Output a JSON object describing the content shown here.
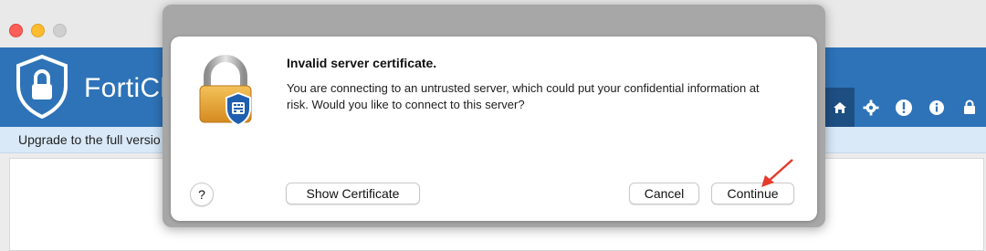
{
  "app": {
    "brand": "FortiCli",
    "banner_text": "Upgrade to the full versio",
    "nav_icons": [
      "home-icon",
      "gear-icon",
      "alert-icon",
      "info-icon",
      "lock-icon"
    ]
  },
  "dialog": {
    "title": "Invalid server certificate.",
    "message": "You are connecting to an untrusted server, which could put your confidential information at risk. Would you like to connect to this server?",
    "help_label": "?",
    "show_certificate_label": "Show Certificate",
    "cancel_label": "Cancel",
    "continue_label": "Continue"
  },
  "colors": {
    "header_blue": "#2e73b8",
    "nav_active": "#1e4f82",
    "arrow_red": "#e53b2c"
  }
}
